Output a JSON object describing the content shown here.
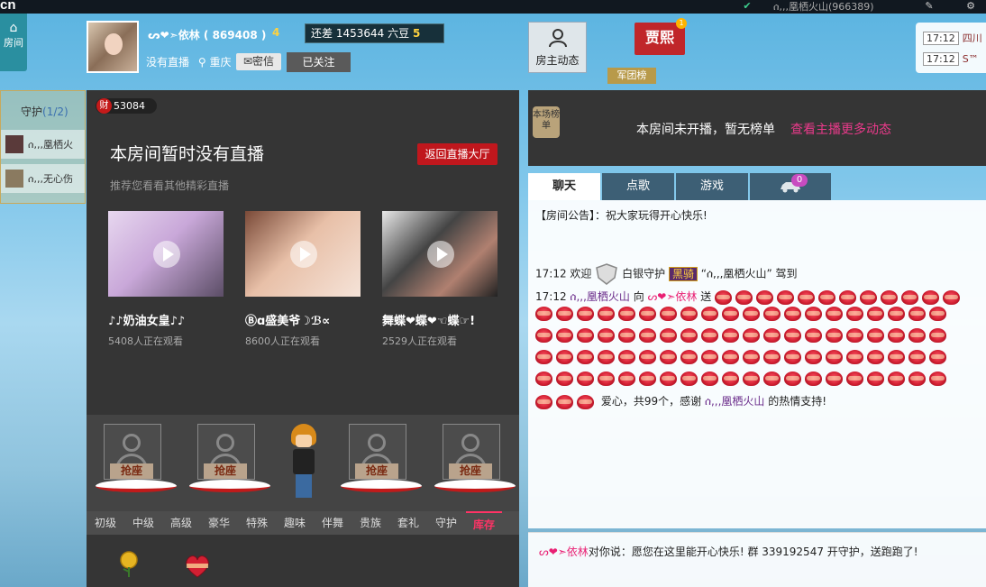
{
  "topbar": {
    "logo": "cn",
    "user": "ሰ,,,凰栖火山(966389)"
  },
  "header": {
    "home_label": "房间",
    "host_name": "ᔕ❤➣依林 ( 869408 )",
    "host_level": "4",
    "gap_prefix": "还差",
    "gap_value": "1453644",
    "gap_unit": "六豆",
    "gap_level": "5",
    "no_live": "没有直播",
    "location": "重庆",
    "mail_label": "密信",
    "follow_label": "已关注",
    "host_dynamic": "房主动态",
    "flag_text": "贾熙",
    "army_label": "军团榜",
    "schedule": [
      {
        "time": "17:12",
        "place": "四川"
      },
      {
        "time": "17:12",
        "place": "S™"
      }
    ]
  },
  "guard": {
    "title": "守护",
    "count": "(1/2)",
    "members": [
      "ሰ,,,凰栖火",
      "ሰ,,,无心伤"
    ]
  },
  "left": {
    "money": "53084",
    "money_icon": "财",
    "no_live_title": "本房间暂时没有直播",
    "back_label": "返回直播大厅",
    "recommend_label": "推荐您看看其他精彩直播",
    "recommendations": [
      {
        "title": "♪♪奶油女皇♪♪",
        "watch": "5408人正在观看"
      },
      {
        "title": "Ⓑɑ盛美爷☽ℬ∝",
        "watch": "8600人正在观看"
      },
      {
        "title": "舞蝶❤蝶❤☜蝶☞!",
        "watch": "2529人正在观看"
      }
    ],
    "seat_label": "抢座",
    "gift_tabs": [
      "初级",
      "中级",
      "高级",
      "豪华",
      "特殊",
      "趣味",
      "伴舞",
      "贵族",
      "套礼",
      "守护",
      "库存"
    ],
    "active_tab": "库存"
  },
  "right": {
    "rank_tag": "本场榜单",
    "rank_msg": "本房间未开播，暂无榜单",
    "rank_link": "查看主播更多动态",
    "chat_tabs": [
      "聊天",
      "点歌",
      "游戏"
    ],
    "car_badge": "0",
    "announce": "【房间公告】：祝大家玩得开心快乐!",
    "welcome_time": "17:12",
    "welcome_text": "欢迎",
    "welcome_role": "白银守护",
    "welcome_badge": "黑骑",
    "welcome_user": "“ሰ,,,凰栖火山” 驾到",
    "gift_time": "17:12",
    "gift_from": "ሰ,,,凰栖火山",
    "gift_to_word": "向",
    "gift_to": "ᔕ❤➣依林",
    "gift_send": "送",
    "gift_summary_pre": "爱心，共99个，感谢",
    "gift_summary_user": "ሰ,,,凰栖火山",
    "gift_summary_post": "的热情支持!",
    "bottom_name": "ᔕ❤➣依林",
    "bottom_text": "对你说：愿您在这里能开心快乐! 群 339192547 开守护，送跑跑了!"
  }
}
